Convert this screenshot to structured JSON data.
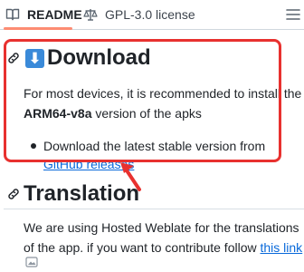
{
  "tabs": [
    {
      "label": "README",
      "icon": "book-icon",
      "active": true
    },
    {
      "label": "GPL-3.0 license",
      "icon": "scale-icon",
      "active": false
    }
  ],
  "download": {
    "emoji": "⬇",
    "title": "Download",
    "text_line1": "For most devices, it is recommended to install the",
    "text_bold": "ARM64-v8a",
    "text_line2_rest": " version of the apks",
    "bullet_text": "Download the latest stable version from",
    "bullet_link": "GitHub releases"
  },
  "translation": {
    "title": "Translation",
    "text_line1": "We are using Hosted Weblate for the translations",
    "text_line2_prefix": "of the app. if you want to contribute follow ",
    "text_link": "this link"
  },
  "colors": {
    "highlight": "#e8312f",
    "link": "#0969da",
    "tab_underline": "#fd8c73",
    "emoji_bg": "#3a8ad9"
  }
}
